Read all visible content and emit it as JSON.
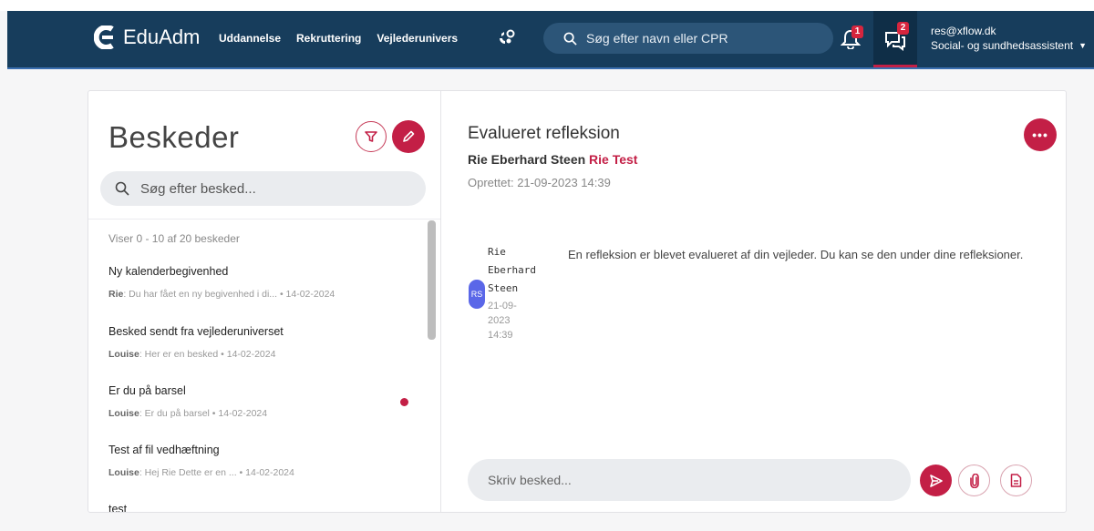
{
  "nav": {
    "logo_text": "EduAdm",
    "links": [
      "Uddannelse",
      "Rekruttering",
      "Vejlederunivers"
    ],
    "search_placeholder": "Søg efter navn eller CPR",
    "notifications_count": "1",
    "messages_count": "2",
    "user_email": "res@xflow.dk",
    "user_role": "Social- og sundhedsassistent",
    "brand_color": "#173d5c",
    "accent_color": "#c31f46"
  },
  "messages_panel": {
    "title": "Beskeder",
    "search_placeholder": "Søg efter besked...",
    "count_text": "Viser 0 - 10 af 20 beskeder",
    "items": [
      {
        "subject": "Ny kalenderbegivenhed",
        "sender": "Rie",
        "preview": ": Du har fået en ny begivenhed i di... • 14-02-2024",
        "unread": false
      },
      {
        "subject": "Besked sendt fra vejlederuniverset",
        "sender": "Louise",
        "preview": ": Her er en besked • 14-02-2024",
        "unread": false
      },
      {
        "subject": "Er du på barsel",
        "sender": "Louise",
        "preview": ": Er du på barsel • 14-02-2024",
        "unread": true
      },
      {
        "subject": "Test af fil vedhæftning",
        "sender": "Louise",
        "preview": ": Hej Rie Dette er en ... • 14-02-2024",
        "unread": false
      },
      {
        "subject": "test",
        "sender": "",
        "preview": "",
        "unread": false
      }
    ]
  },
  "conversation": {
    "title": "Evalueret refleksion",
    "participant_primary": "Rie Eberhard Steen",
    "participant_secondary": "Rie Test",
    "created": "Oprettet: 21-09-2023 14:39",
    "more_label": "•••",
    "message": {
      "sender_line1": "Rie",
      "sender_line2": "Eberhard",
      "sender_line3": "Steen",
      "avatar_initials": "RS",
      "date_line1": "21-09-",
      "date_line2": "2023",
      "date_line3": "14:39",
      "text": "En refleksion er blevet evalueret af din vejleder. Du kan se den under dine refleksioner."
    },
    "compose_placeholder": "Skriv besked..."
  }
}
